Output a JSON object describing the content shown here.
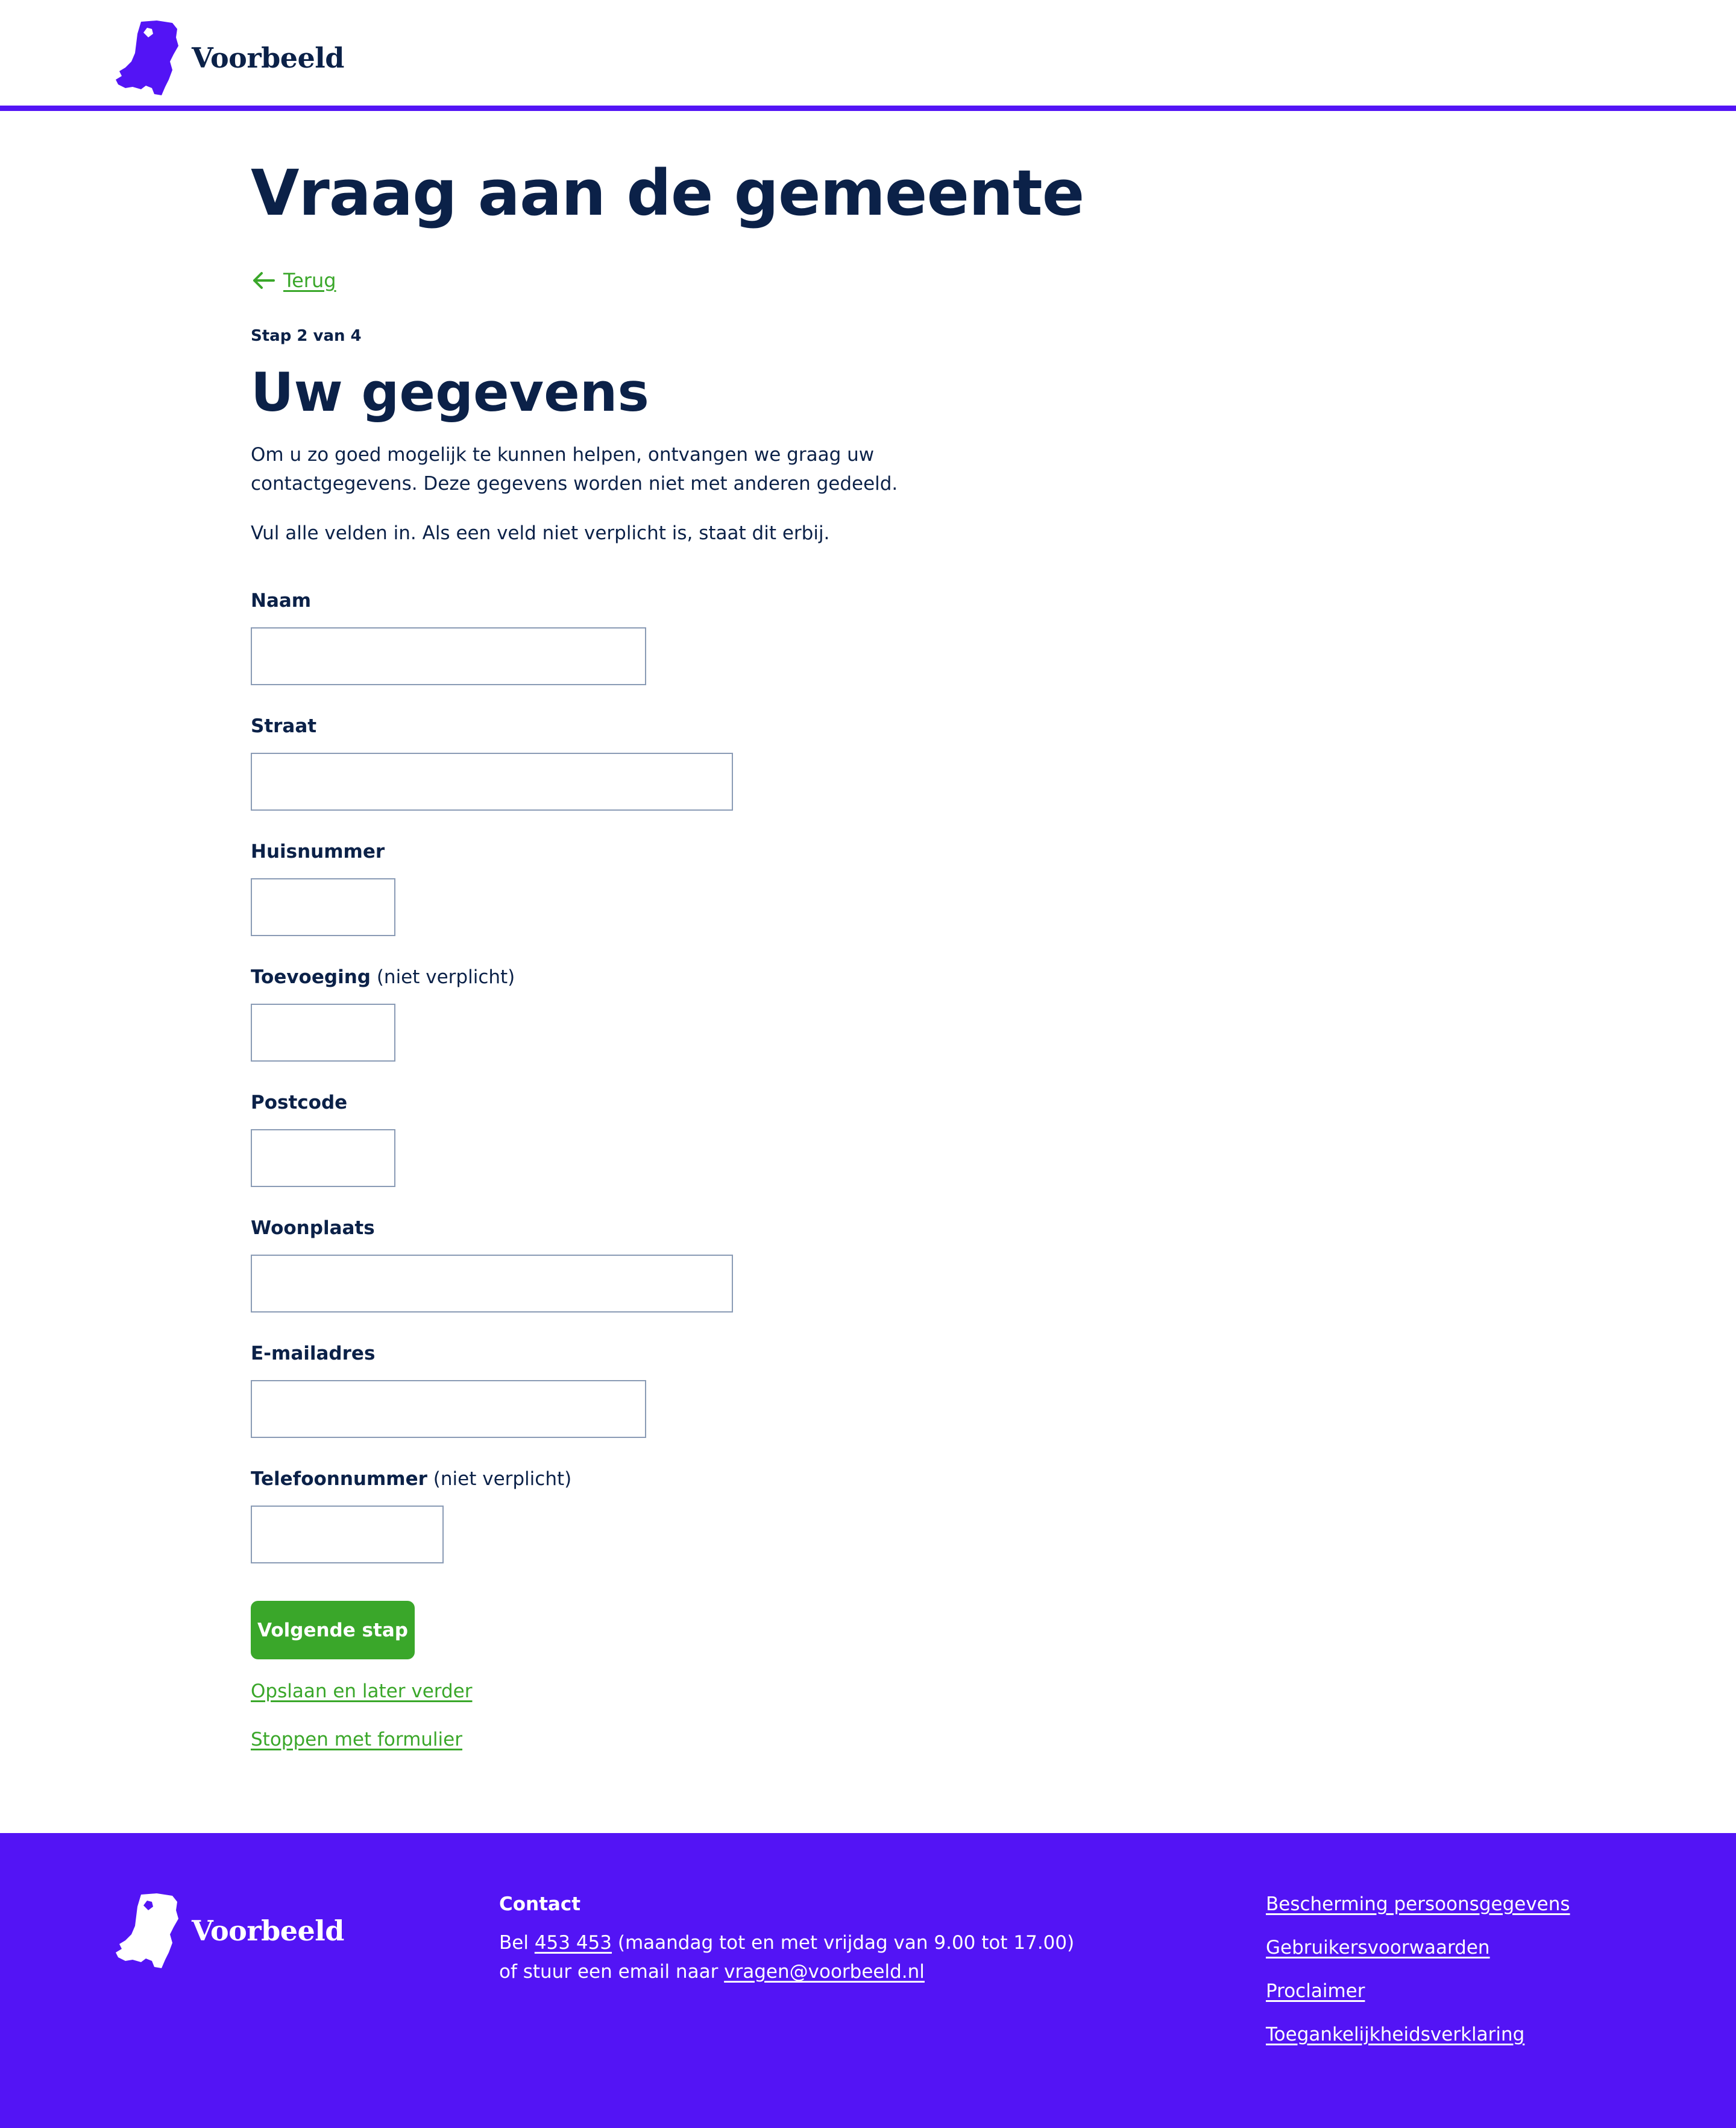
{
  "header": {
    "logo_text": "Voorbeeld"
  },
  "page": {
    "title": "Vraag aan de gemeente",
    "back_label": "Terug",
    "step": "Stap 2 van 4",
    "section_title": "Uw gegevens",
    "intro": "Om u zo goed mogelijk te kunnen helpen, ontvangen we graag uw contactgegevens. Deze gegevens worden niet met anderen gedeeld.",
    "instruction": "Vul alle velden in. Als een veld niet verplicht is, staat dit erbij."
  },
  "form": {
    "optional_suffix": "(niet verplicht)",
    "fields": [
      {
        "label": "Naam",
        "value": ""
      },
      {
        "label": "Straat",
        "value": ""
      },
      {
        "label": "Huisnummer",
        "value": ""
      },
      {
        "label": "Toevoeging",
        "value": ""
      },
      {
        "label": "Postcode",
        "value": ""
      },
      {
        "label": "Woonplaats",
        "value": ""
      },
      {
        "label": "E-mailadres",
        "value": ""
      },
      {
        "label": "Telefoonnummer",
        "value": ""
      }
    ],
    "next_button": "Volgende stap",
    "save_link": "Opslaan en later verder",
    "stop_link": "Stoppen met formulier"
  },
  "footer": {
    "logo_text": "Voorbeeld",
    "contact_heading": "Contact",
    "phone_prefix": "Bel",
    "phone": "453 453",
    "hours": "(maandag tot en met vrijdag van 9.00 tot 17.00)",
    "email_prefix": "of stuur een email naar",
    "email": "vragen@voorbeeld.nl",
    "links": [
      "Bescherming persoonsgegevens",
      "Gebruikersvoorwaarden",
      "Proclaimer",
      "Toegankelijkheidsverklaring"
    ]
  },
  "colors": {
    "brand": "#5314f5",
    "accent_green": "#3aa72a",
    "text": "#0b2148"
  }
}
